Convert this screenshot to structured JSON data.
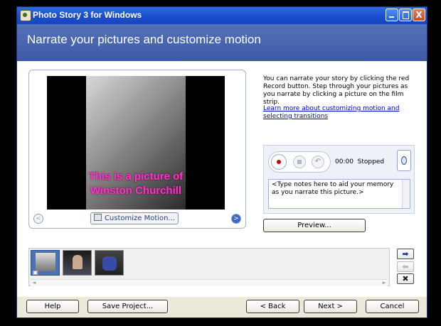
{
  "window": {
    "title": "Photo Story 3 for Windows",
    "close_label": "X"
  },
  "header": {
    "title": "Narrate your pictures and customize motion"
  },
  "preview": {
    "overlay_line1": "This is a picture of",
    "overlay_line2": "Winston Churchill",
    "customize_motion_label": "Customize Motion...",
    "nav_left": "<",
    "nav_right": ">"
  },
  "instructions": {
    "text": "You can narrate your story by clicking the red Record button. Step through your pictures as you narrate by clicking a picture on the film strip.",
    "learn_link": "Learn more about customizing motion and selecting transitions"
  },
  "recorder": {
    "time": "00:00",
    "status": "Stopped",
    "undo_glyph": "↶",
    "notes_placeholder": "<Type notes here to aid your memory as you narrate this picture.>"
  },
  "preview_button": "Preview...",
  "filmstrip": {
    "arrow_left": "◄",
    "arrow_right": "►"
  },
  "side_buttons": {
    "move_right": "➡",
    "move_left": "⬅",
    "delete": "✖"
  },
  "footer": {
    "help": "Help",
    "save_project": "Save Project...",
    "back": "< Back",
    "next": "Next >",
    "cancel": "Cancel"
  }
}
